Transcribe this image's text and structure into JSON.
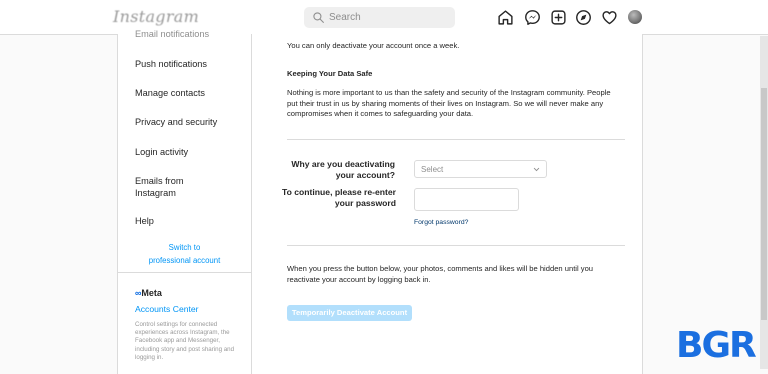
{
  "app": {
    "logo_text": "Instagram",
    "search": {
      "placeholder": "Search",
      "value": ""
    },
    "nav_icons": [
      "home-icon",
      "messenger-icon",
      "new-post-icon",
      "explore-icon",
      "activity-heart-icon",
      "profile-avatar"
    ]
  },
  "sidebar": {
    "items": [
      {
        "label": "Email notifications"
      },
      {
        "label": "Push notifications"
      },
      {
        "label": "Manage contacts"
      },
      {
        "label": "Privacy and security"
      },
      {
        "label": "Login activity"
      },
      {
        "label": "Emails from Instagram"
      },
      {
        "label": "Help"
      }
    ],
    "switch_link": "Switch to professional account",
    "meta": {
      "logo": "Meta",
      "accounts_center": "Accounts Center",
      "description": "Control settings for connected experiences across Instagram, the Facebook app and Messenger, including story and post sharing and logging in."
    }
  },
  "main": {
    "notice": "You can only deactivate your account once a week.",
    "safe_heading": "Keeping Your Data Safe",
    "safe_body": "Nothing is more important to us than the safety and security of the Instagram community. People put their trust in us by sharing moments of their lives on Instagram. So we will never make any compromises when it comes to safeguarding your data.",
    "reason_label": "Why are you deactivating your account?",
    "reason_select": "Select",
    "password_label": "To continue, please re-enter your password",
    "password_value": "",
    "forgot_password": "Forgot password?",
    "footer_text": "When you press the button below, your photos, comments and likes will be hidden until you reactivate your account by logging back in.",
    "deactivate_button": "Temporarily Deactivate Account"
  },
  "watermark": {
    "text": "BGR",
    "color": "#1b6fe0"
  },
  "colors": {
    "accent": "#0095f6",
    "button_disabled": "#b2dffc",
    "border": "#dbdbdb"
  }
}
